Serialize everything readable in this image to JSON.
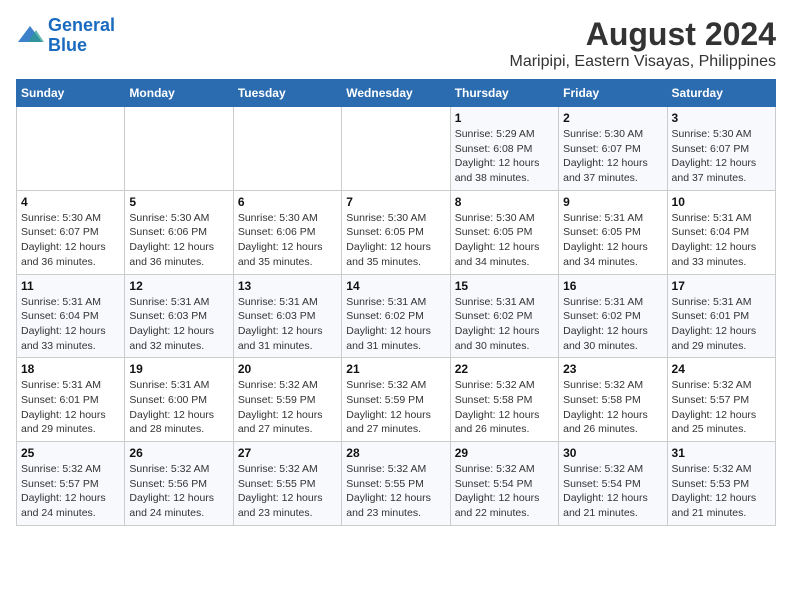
{
  "logo": {
    "line1": "General",
    "line2": "Blue"
  },
  "title": "August 2024",
  "subtitle": "Maripipi, Eastern Visayas, Philippines",
  "days_of_week": [
    "Sunday",
    "Monday",
    "Tuesday",
    "Wednesday",
    "Thursday",
    "Friday",
    "Saturday"
  ],
  "weeks": [
    [
      {
        "day": "",
        "info": ""
      },
      {
        "day": "",
        "info": ""
      },
      {
        "day": "",
        "info": ""
      },
      {
        "day": "",
        "info": ""
      },
      {
        "day": "1",
        "info": "Sunrise: 5:29 AM\nSunset: 6:08 PM\nDaylight: 12 hours\nand 38 minutes."
      },
      {
        "day": "2",
        "info": "Sunrise: 5:30 AM\nSunset: 6:07 PM\nDaylight: 12 hours\nand 37 minutes."
      },
      {
        "day": "3",
        "info": "Sunrise: 5:30 AM\nSunset: 6:07 PM\nDaylight: 12 hours\nand 37 minutes."
      }
    ],
    [
      {
        "day": "4",
        "info": "Sunrise: 5:30 AM\nSunset: 6:07 PM\nDaylight: 12 hours\nand 36 minutes."
      },
      {
        "day": "5",
        "info": "Sunrise: 5:30 AM\nSunset: 6:06 PM\nDaylight: 12 hours\nand 36 minutes."
      },
      {
        "day": "6",
        "info": "Sunrise: 5:30 AM\nSunset: 6:06 PM\nDaylight: 12 hours\nand 35 minutes."
      },
      {
        "day": "7",
        "info": "Sunrise: 5:30 AM\nSunset: 6:05 PM\nDaylight: 12 hours\nand 35 minutes."
      },
      {
        "day": "8",
        "info": "Sunrise: 5:30 AM\nSunset: 6:05 PM\nDaylight: 12 hours\nand 34 minutes."
      },
      {
        "day": "9",
        "info": "Sunrise: 5:31 AM\nSunset: 6:05 PM\nDaylight: 12 hours\nand 34 minutes."
      },
      {
        "day": "10",
        "info": "Sunrise: 5:31 AM\nSunset: 6:04 PM\nDaylight: 12 hours\nand 33 minutes."
      }
    ],
    [
      {
        "day": "11",
        "info": "Sunrise: 5:31 AM\nSunset: 6:04 PM\nDaylight: 12 hours\nand 33 minutes."
      },
      {
        "day": "12",
        "info": "Sunrise: 5:31 AM\nSunset: 6:03 PM\nDaylight: 12 hours\nand 32 minutes."
      },
      {
        "day": "13",
        "info": "Sunrise: 5:31 AM\nSunset: 6:03 PM\nDaylight: 12 hours\nand 31 minutes."
      },
      {
        "day": "14",
        "info": "Sunrise: 5:31 AM\nSunset: 6:02 PM\nDaylight: 12 hours\nand 31 minutes."
      },
      {
        "day": "15",
        "info": "Sunrise: 5:31 AM\nSunset: 6:02 PM\nDaylight: 12 hours\nand 30 minutes."
      },
      {
        "day": "16",
        "info": "Sunrise: 5:31 AM\nSunset: 6:02 PM\nDaylight: 12 hours\nand 30 minutes."
      },
      {
        "day": "17",
        "info": "Sunrise: 5:31 AM\nSunset: 6:01 PM\nDaylight: 12 hours\nand 29 minutes."
      }
    ],
    [
      {
        "day": "18",
        "info": "Sunrise: 5:31 AM\nSunset: 6:01 PM\nDaylight: 12 hours\nand 29 minutes."
      },
      {
        "day": "19",
        "info": "Sunrise: 5:31 AM\nSunset: 6:00 PM\nDaylight: 12 hours\nand 28 minutes."
      },
      {
        "day": "20",
        "info": "Sunrise: 5:32 AM\nSunset: 5:59 PM\nDaylight: 12 hours\nand 27 minutes."
      },
      {
        "day": "21",
        "info": "Sunrise: 5:32 AM\nSunset: 5:59 PM\nDaylight: 12 hours\nand 27 minutes."
      },
      {
        "day": "22",
        "info": "Sunrise: 5:32 AM\nSunset: 5:58 PM\nDaylight: 12 hours\nand 26 minutes."
      },
      {
        "day": "23",
        "info": "Sunrise: 5:32 AM\nSunset: 5:58 PM\nDaylight: 12 hours\nand 26 minutes."
      },
      {
        "day": "24",
        "info": "Sunrise: 5:32 AM\nSunset: 5:57 PM\nDaylight: 12 hours\nand 25 minutes."
      }
    ],
    [
      {
        "day": "25",
        "info": "Sunrise: 5:32 AM\nSunset: 5:57 PM\nDaylight: 12 hours\nand 24 minutes."
      },
      {
        "day": "26",
        "info": "Sunrise: 5:32 AM\nSunset: 5:56 PM\nDaylight: 12 hours\nand 24 minutes."
      },
      {
        "day": "27",
        "info": "Sunrise: 5:32 AM\nSunset: 5:55 PM\nDaylight: 12 hours\nand 23 minutes."
      },
      {
        "day": "28",
        "info": "Sunrise: 5:32 AM\nSunset: 5:55 PM\nDaylight: 12 hours\nand 23 minutes."
      },
      {
        "day": "29",
        "info": "Sunrise: 5:32 AM\nSunset: 5:54 PM\nDaylight: 12 hours\nand 22 minutes."
      },
      {
        "day": "30",
        "info": "Sunrise: 5:32 AM\nSunset: 5:54 PM\nDaylight: 12 hours\nand 21 minutes."
      },
      {
        "day": "31",
        "info": "Sunrise: 5:32 AM\nSunset: 5:53 PM\nDaylight: 12 hours\nand 21 minutes."
      }
    ]
  ]
}
